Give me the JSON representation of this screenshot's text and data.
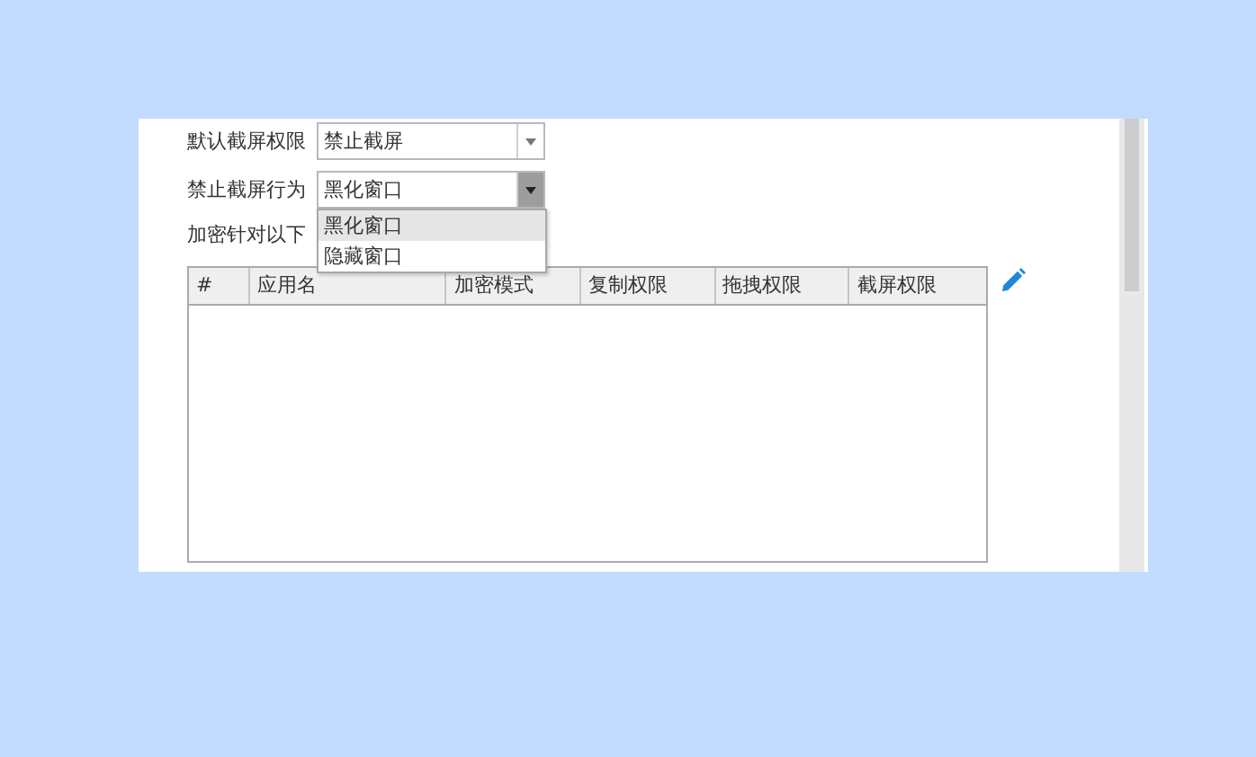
{
  "settings": [
    {
      "label": "默认截屏权限",
      "value": "禁止截屏",
      "open": false
    },
    {
      "label": "禁止截屏行为",
      "value": "黑化窗口",
      "open": true
    }
  ],
  "dropdown": {
    "options": [
      {
        "label": "黑化窗口",
        "selected": true
      },
      {
        "label": "隐藏窗口",
        "selected": false
      }
    ]
  },
  "table_caption": "加密针对以下",
  "table": {
    "columns": [
      "#",
      "应用名",
      "加密模式",
      "复制权限",
      "拖拽权限",
      "截屏权限"
    ]
  }
}
